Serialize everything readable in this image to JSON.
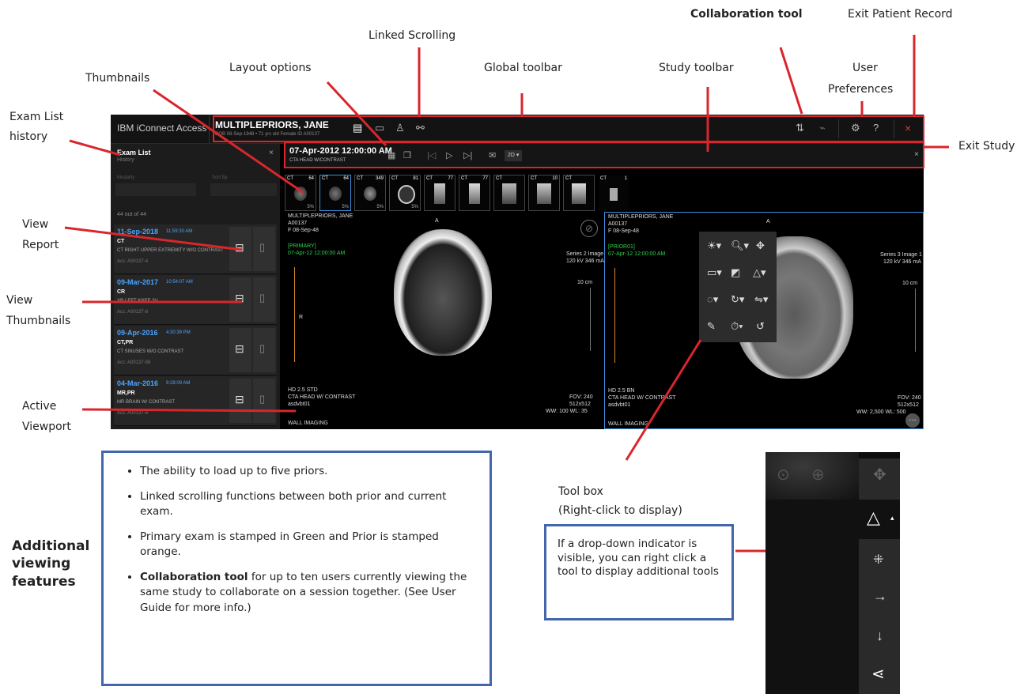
{
  "callouts": {
    "collaboration_tool": "Collaboration tool",
    "exit_patient_record": "Exit Patient Record",
    "linked_scrolling": "Linked Scrolling",
    "layout_options": "Layout options",
    "global_toolbar": "Global toolbar",
    "study_toolbar": "Study toolbar",
    "user_prefs_line1": "User",
    "user_prefs_line2": "Preferences",
    "thumbnails": "Thumbnails",
    "exam_list_line1": "Exam List",
    "exam_list_line2": "history",
    "exit_study": "Exit Study",
    "view_report_line1": "View",
    "view_report_line2": "Report",
    "view_thumbs_line1": "View",
    "view_thumbs_line2": "Thumbnails",
    "active_line1": "Active",
    "active_line2": "Viewport",
    "toolbox_line1": "Tool box",
    "toolbox_line2": "(Right-click to display)"
  },
  "app": {
    "brand": "IBM iConnect Access",
    "patient_name": "MULTIPLEPRIORS, JANE",
    "patient_info": "DOB 08-Sep-1948 • 71 yrs old  Female  ID A00137",
    "sidebar": {
      "title": "Exam List",
      "subtitle": "History",
      "close": "×",
      "modality_label": "Modality",
      "sort_label": "Sort By",
      "count": "44 out of 44",
      "exams": [
        {
          "date": "11-Sep-2018",
          "time": "11:59:30 AM",
          "modality": "CT",
          "desc": "CT RIGHT UPPER EXTREMITY W/O CONTRAST",
          "acc": "Acc: A00137-4"
        },
        {
          "date": "09-Mar-2017",
          "time": "10:54:07 AM",
          "modality": "CR",
          "desc": "XR LEFT KNEE 3V",
          "acc": "Acc: A00137-8"
        },
        {
          "date": "09-Apr-2016",
          "time": "4:30:39 PM",
          "modality": "CT,PR",
          "desc": "CT SINUSES W/O CONTRAST",
          "acc": "Acc: A00137-56"
        },
        {
          "date": "04-Mar-2016",
          "time": "9:28:09 AM",
          "modality": "MR,PR",
          "desc": "MR BRAIN W/ CONTRAST",
          "acc": "Acc: A00137-6"
        }
      ]
    },
    "study": {
      "datetime": "07-Apr-2012 12:00:00 AM",
      "desc": "CTA HEAD W/CONTRAST",
      "mode": "2D ▾",
      "close": "×"
    },
    "thumbs": [
      {
        "label": "CT",
        "count": "64",
        "pct": "5%"
      },
      {
        "label": "CT",
        "count": "64",
        "pct": "5%"
      },
      {
        "label": "CT",
        "count": "349",
        "pct": "5%"
      },
      {
        "label": "CT",
        "count": "81",
        "pct": "5%"
      },
      {
        "label": "CT",
        "count": "77",
        "pct": ""
      },
      {
        "label": "CT",
        "count": "77",
        "pct": ""
      },
      {
        "label": "CT",
        "count": "",
        "pct": ""
      },
      {
        "label": "CT",
        "count": "10",
        "pct": ""
      },
      {
        "label": "CT",
        "count": "",
        "pct": ""
      },
      {
        "label": "CT",
        "count": "1",
        "pct": ""
      }
    ],
    "left_viewport": {
      "name": "MULTIPLEPRIORS, JANE",
      "id": "A00137",
      "dob": "F 08-Sep-48",
      "stamp": "[PRIMARY]",
      "stamp_date": "07-Apr-12 12:00:00 AM",
      "orient_top": "A",
      "orient_left": "R",
      "series": "Series 2 Image 1",
      "kv": "120 kV 346 mA",
      "scale": "10 cm",
      "bottom1": "HD 2.5 STD",
      "bottom2": "CTA HEAD W/ CONTRAST",
      "bottom3": "asdvbt01",
      "footer": "WALL IMAGING",
      "fov": "FOV: 240",
      "matrix": "512x512",
      "ww": "WW: 100 WL: 35"
    },
    "right_viewport": {
      "name": "MULTIPLEPRIORS, JANE",
      "id": "A00137",
      "dob": "F 08-Sep-48",
      "stamp": "[PRIOR01]",
      "stamp_date": "07-Apr-12 12:00:00 AM",
      "orient_top": "A",
      "series": "Series 3 Image 1",
      "kv": "120 kV 346 mA",
      "scale": "10 cm",
      "bottom1": "HD 2.5 BN",
      "bottom2": "CTA HEAD W/ CONTRAST",
      "bottom3": "asdvbt01",
      "footer": "WALL IMAGING",
      "fov": "FOV: 240",
      "matrix": "512x512",
      "ww": "WW: 2,500 WL: 500"
    }
  },
  "description": {
    "heading_line1": "Additional",
    "heading_line2": "viewing",
    "heading_line3": "features",
    "bullet1": "The ability to load up to five priors.",
    "bullet2": "Linked scrolling functions between both prior and current exam.",
    "bullet3": "Primary exam is stamped in Green and Prior is stamped orange.",
    "bullet4_bold": "Collaboration tool",
    "bullet4_rest": " for up to ten users currently viewing the same study to collaborate on a session together. (See User Guide for more info.)"
  },
  "dropdown_note": "If a drop-down indicator is visible, you can right click a tool to display additional tools",
  "colors": {
    "callout_line": "#d9262c",
    "box_border": "#4466aa",
    "primary_stamp": "#2fd14a",
    "date_link": "#4aa3ff"
  }
}
